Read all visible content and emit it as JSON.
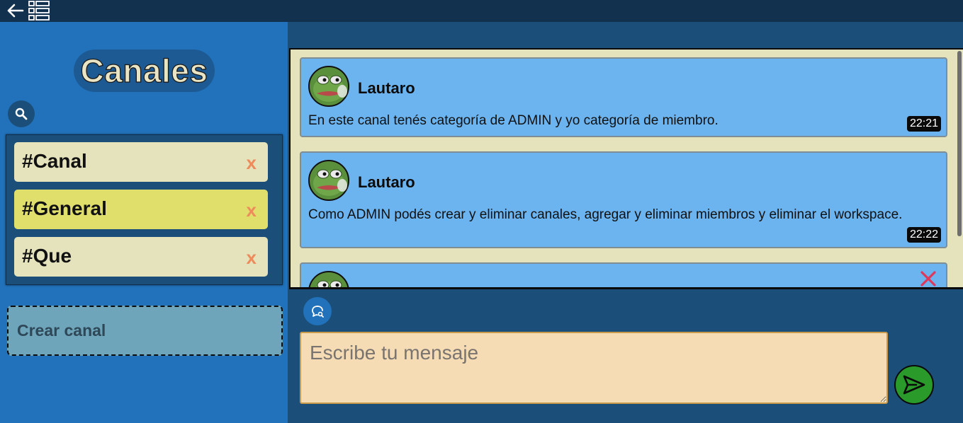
{
  "sidebar": {
    "title": "Canales",
    "channels": [
      {
        "name": "#Canal",
        "delete": "x",
        "active": false
      },
      {
        "name": "#General",
        "delete": "x",
        "active": true
      },
      {
        "name": "#Que",
        "delete": "x",
        "active": false
      }
    ],
    "create_label": "Crear canal"
  },
  "messages": [
    {
      "author": "Lautaro",
      "text": "En este canal tenés categoría de ADMIN y yo categoría de miembro.",
      "time": "22:21"
    },
    {
      "author": "Lautaro",
      "text": "Como ADMIN podés crear y eliminar canales, agregar y eliminar miembros y eliminar el workspace.",
      "time": "22:22"
    }
  ],
  "composer": {
    "placeholder": "Escribe tu mensaje"
  },
  "icons": {
    "back": "arrow-left-icon",
    "menu": "list-icon",
    "search": "search-icon",
    "chat_search": "chat-search-icon",
    "send": "send-icon",
    "delete": "close-icon"
  },
  "colors": {
    "topbar": "#12314f",
    "sidebar": "#2172bb",
    "panel": "#1b4f7a",
    "channel": "#e5e3bc",
    "channel_active": "#e1df6c",
    "delete_x": "#ef8a5a",
    "message_bubble": "#6bb4ef",
    "input": "#f5dcb4",
    "send": "#2a9a2a",
    "remove_x": "#e0385a"
  }
}
